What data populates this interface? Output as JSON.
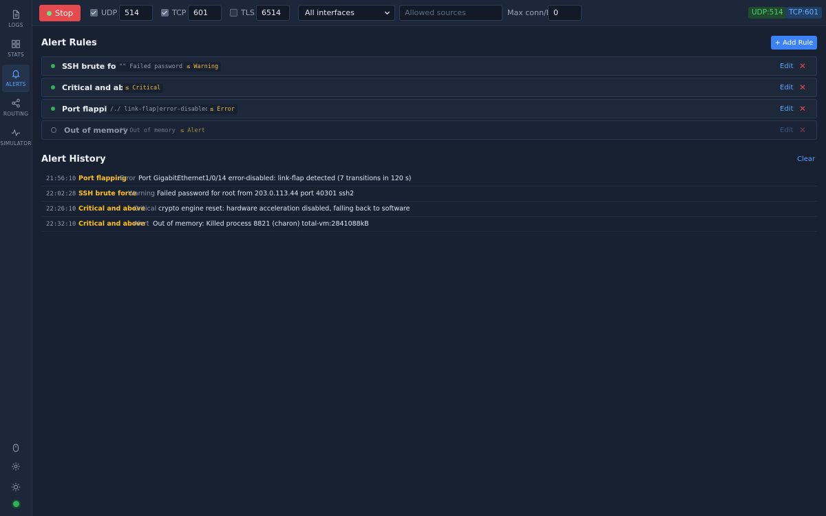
{
  "sidebar": {
    "items": [
      {
        "label": "LOGS",
        "icon": "logs-icon"
      },
      {
        "label": "STATS",
        "icon": "stats-grid-icon"
      },
      {
        "label": "ALERTS",
        "icon": "bell-icon"
      },
      {
        "label": "ROUTING",
        "icon": "share-nodes-icon"
      },
      {
        "label": "SIMULATOR",
        "icon": "pulse-icon"
      }
    ],
    "active": "ALERTS",
    "bottom_icons": [
      "mouse-icon",
      "gear-icon",
      "sun-icon"
    ],
    "status_color": "#2fb25a"
  },
  "topbar": {
    "stop_label": "Stop",
    "udp": {
      "label": "UDP",
      "checked": true,
      "port": "514"
    },
    "tcp": {
      "label": "TCP",
      "checked": true,
      "port": "601"
    },
    "tls": {
      "label": "TLS",
      "checked": false,
      "port": "6514"
    },
    "interface_select": "All interfaces",
    "allowed_sources_placeholder": "Allowed sources",
    "max_conn_label": "Max conn/IP",
    "max_conn_value": "0",
    "badges": {
      "udp": "UDP:514",
      "tcp": "TCP:601"
    }
  },
  "alert_rules": {
    "title": "Alert Rules",
    "add_label": "+ Add Rule",
    "edit_label": "Edit",
    "rules": [
      {
        "name": "SSH brute force",
        "pattern": "\"\" Failed password",
        "severity": "≤ Warning",
        "enabled": true
      },
      {
        "name": "Critical and above",
        "pattern": "",
        "severity": "≤ Critical",
        "enabled": true
      },
      {
        "name": "Port flapping",
        "pattern": "/./ link-flap|error-disabled",
        "severity": "≤ Error",
        "enabled": true
      },
      {
        "name": "Out of memory",
        "pattern": "\"\" Out of memory",
        "severity": "≤ Alert",
        "enabled": false
      }
    ]
  },
  "alert_history": {
    "title": "Alert History",
    "clear_label": "Clear",
    "entries": [
      {
        "time": "21:56:10",
        "rule": "Port flapping",
        "severity": "Error",
        "message": "Port GigabitEthernet1/0/14 error-disabled: link-flap detected (7 transitions in 120 s)"
      },
      {
        "time": "22:02:28",
        "rule": "SSH brute force",
        "severity": "Warning",
        "message": "Failed password for root from 203.0.113.44 port 40301 ssh2"
      },
      {
        "time": "22:26:10",
        "rule": "Critical and above",
        "severity": "Critical",
        "message": "crypto engine reset: hardware acceleration disabled, falling back to software"
      },
      {
        "time": "22:32:10",
        "rule": "Critical and above",
        "severity": "Alert",
        "message": "Out of memory: Killed process 8821 (charon) total-vm:2841088kB"
      }
    ]
  },
  "colors": {
    "accent": "#3b82f6",
    "danger": "#e5484d",
    "severity": "#e8b93e",
    "rule_highlight": "#ffc01e",
    "ok": "#2fb25a"
  }
}
